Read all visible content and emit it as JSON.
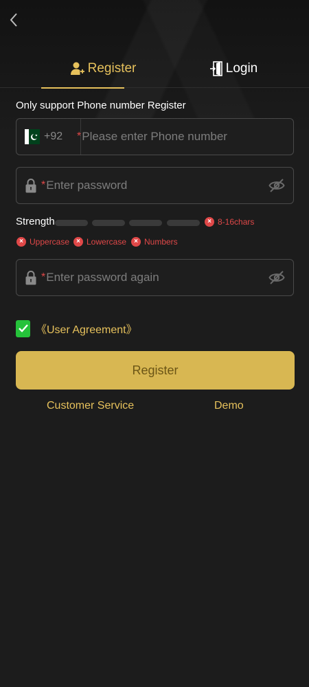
{
  "tabs": {
    "register_label": "Register",
    "login_label": "Login"
  },
  "form": {
    "subtitle": "Only support Phone number Register",
    "phone": {
      "country_code": "+92",
      "required_mark": "*",
      "placeholder": "Please enter Phone number",
      "value": ""
    },
    "password": {
      "required_mark": "*",
      "placeholder": "Enter password",
      "value": ""
    },
    "password_again": {
      "required_mark": "*",
      "placeholder": "Enter password again",
      "value": ""
    },
    "strength": {
      "label": "Strength",
      "level": 0,
      "rules": {
        "length": "8-16chars",
        "uppercase": "Uppercase",
        "lowercase": "Lowercase",
        "numbers": "Numbers"
      }
    },
    "agreement": {
      "checked": true,
      "label": "《User Agreement》"
    },
    "submit_label": "Register"
  },
  "footer": {
    "customer_service": "Customer Service",
    "demo": "Demo"
  },
  "colors": {
    "background": "#1c1c1c",
    "accent_gold": "#e6c15c",
    "button_gold": "#d8b752",
    "error_red": "#e04848",
    "checkbox_green": "#25c23a"
  },
  "icons": {
    "back": "chevron-left-icon",
    "register": "user-add-icon",
    "login": "door-enter-icon",
    "lock": "lock-icon",
    "eye_hidden": "eye-off-icon",
    "error": "x-circle-icon",
    "check": "check-icon",
    "flag": "pakistan-flag-icon"
  }
}
